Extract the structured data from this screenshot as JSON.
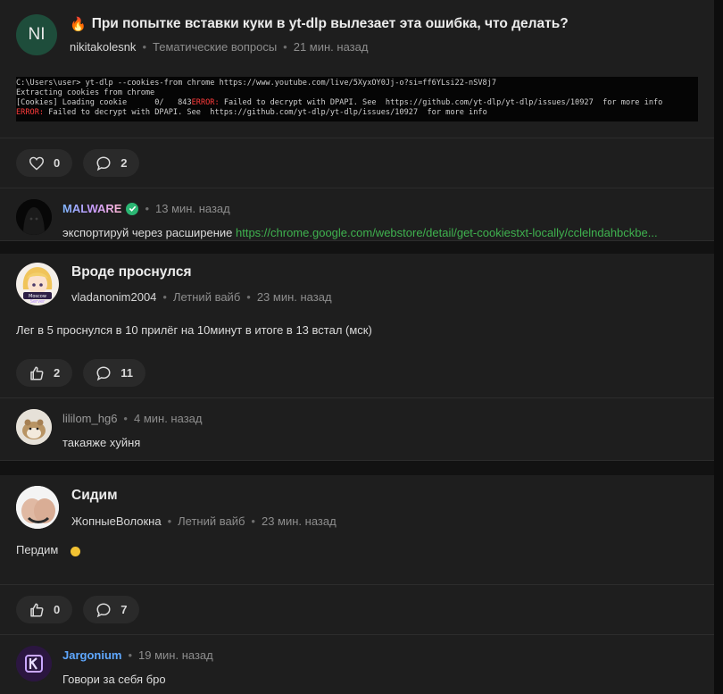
{
  "posts": [
    {
      "avatar_text": "NI",
      "title": "При попытке вставки куки в yt-dlp вылезает эта ошибка, что делать?",
      "title_icon": "fire-icon",
      "author": "nikitakolesnk",
      "category": "Тематические вопросы",
      "time": "21 мин. назад",
      "code": {
        "line1": "C:\\Users\\user> yt-dlp --cookies-from chrome https://www.youtube.com/live/5XyxOY0Jj-o?si=ff6YLsi22-nSV8j7",
        "line2": "Extracting cookies from chrome",
        "line3_a": "[Cookies] Loading cookie      0/   843",
        "line3_err": "ERROR:",
        "line3_b": " Failed to decrypt with DPAPI. See  https://github.com/yt-dlp/yt-dlp/issues/10927  for more info",
        "line4_err": "ERROR:",
        "line4_b": " Failed to decrypt with DPAPI. See  https://github.com/yt-dlp/yt-dlp/issues/10927  for more info"
      },
      "likes": "0",
      "comments": "2",
      "comment": {
        "author": "MALWARE",
        "time": "13 мин. назад",
        "text": "экспортируй через расширение ",
        "link": "https://chrome.google.com/webstore/detail/get-cookiestxt-locally/cclelndahbckbe..."
      }
    },
    {
      "title": "Вроде проснулся",
      "author": "vladanonim2004",
      "category": "Летний вайб",
      "time": "23 мин. назад",
      "body": "Лег в 5 проснулся в 10 прилёг на 10минут в итоге в 13 встал (мск)",
      "likes": "2",
      "comments": "11",
      "comment": {
        "author": "lililom_hg6",
        "time": "4 мин. назад",
        "text": "такаяже хуйня"
      }
    },
    {
      "title": "Сидим",
      "author": "ЖопныеВолокна",
      "category": "Летний вайб",
      "time": "23 мин. назад",
      "body": "Пердим",
      "likes": "0",
      "comments": "7",
      "comment": {
        "author": "Jargonium",
        "time": "19 мин. назад",
        "text": "Говори за себя бро"
      }
    }
  ],
  "colors": {
    "background": "#121212",
    "card": "#1e1e1e",
    "link_green": "#3fb24f",
    "error_red": "#ff3b3b",
    "verified_green": "#2bb673",
    "jargonium_blue": "#5fa8ff"
  }
}
